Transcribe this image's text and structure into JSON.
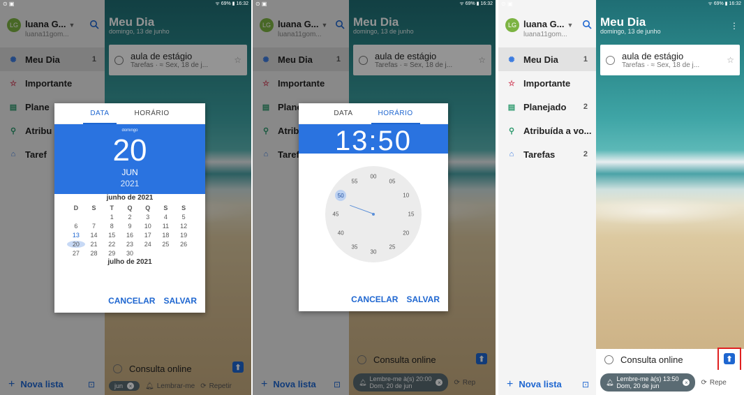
{
  "shared": {
    "user_name": "luana G...",
    "user_email": "luana11gom...",
    "avatar_initials": "LG",
    "nav": [
      {
        "label": "Meu Dia",
        "count": "1"
      },
      {
        "label": "Importante",
        "count": ""
      },
      {
        "label": "Planejado",
        "count": "2"
      },
      {
        "label": "Atribuída a vo...",
        "count": ""
      },
      {
        "label": "Tarefas",
        "count": "2"
      }
    ],
    "nav_truncated": [
      "Plane",
      "Atribu",
      "Taref"
    ],
    "new_list": "Nova lista",
    "header_title": "Meu Dia",
    "header_date": "domingo, 13 de junho",
    "task_title": "aula de estágio",
    "task_meta": "Tarefas · ≈ Sex, 18 de j...",
    "compose_text": "Consulta online",
    "remind_label": "Lembrar-me",
    "repeat_label": "Repetir",
    "repeat_trunc": "Rep",
    "repeat_trunc3": "Repe"
  },
  "status_bars": [
    {
      "left": "⊙ ▣",
      "right": "ᯤ 69% ▮ 16:32"
    },
    {
      "left": "⊙ ▣",
      "right": "ᯤ 69% ▮ 16:32"
    },
    {
      "left": "⊙ ▣",
      "right": "ᯤ 69% ▮ 16:32"
    }
  ],
  "panel1": {
    "tab_date": "DATA",
    "tab_time": "HORÁRIO",
    "weekday": "domingo",
    "day": "20",
    "month": "JUN",
    "year": "2021",
    "month_title": "junho de 2021",
    "weekday_heads": [
      "D",
      "S",
      "T",
      "Q",
      "Q",
      "S",
      "S"
    ],
    "weeks": [
      [
        "",
        "",
        "1",
        "2",
        "3",
        "4",
        "5"
      ],
      [
        "6",
        "7",
        "8",
        "9",
        "10",
        "11",
        "12"
      ],
      [
        "13",
        "14",
        "15",
        "16",
        "17",
        "18",
        "19"
      ],
      [
        "20",
        "21",
        "22",
        "23",
        "24",
        "25",
        "26"
      ],
      [
        "27",
        "28",
        "29",
        "30",
        "",
        "",
        ""
      ]
    ],
    "next_month_title": "julho de 2021",
    "cancel": "CANCELAR",
    "save": "SALVAR",
    "chip_partial": "jun"
  },
  "panel2": {
    "tab_date": "DATA",
    "tab_time": "HORÁRIO",
    "time": "13:50",
    "minutes": [
      "00",
      "05",
      "10",
      "15",
      "20",
      "25",
      "30",
      "35",
      "40",
      "45",
      "50",
      "55"
    ],
    "selected_minute": "50",
    "cancel": "CANCELAR",
    "save": "SALVAR",
    "chip_line1": "Lembre-me à(s) 20:00",
    "chip_line2": "Dom, 20 de jun"
  },
  "panel3": {
    "chip_line1": "Lembre-me à(s) 13:50",
    "chip_line2": "Dom, 20 de jun"
  },
  "colors": {
    "accent": "#2a73e0",
    "highlight": "#e02020"
  }
}
